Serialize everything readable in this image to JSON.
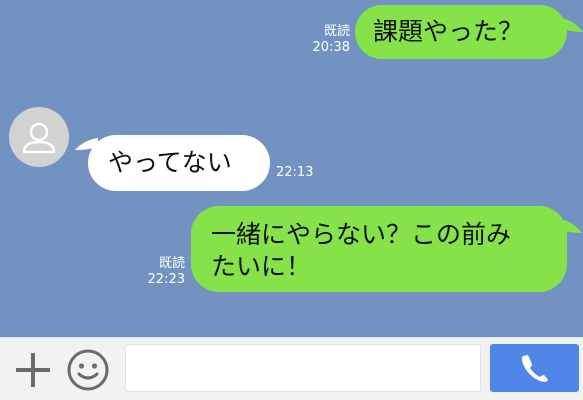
{
  "chat": {
    "messages": [
      {
        "sender": "me",
        "lines": [
          "課題やった？"
        ],
        "read": "既読",
        "time": "20:38"
      },
      {
        "sender": "friend",
        "lines": [
          "やってない"
        ],
        "time": "22:13"
      },
      {
        "sender": "me",
        "lines": [
          "一緒にやらない？この前み",
          "たいに！"
        ],
        "read": "既読",
        "time": "22:23"
      }
    ]
  },
  "input": {
    "placeholder": ""
  },
  "icons": {
    "add": "plus-icon",
    "emoji": "smiley-icon",
    "send": "phone-icon",
    "avatar": "user-icon"
  },
  "colors": {
    "background": "#7293c2",
    "sent_bubble": "#85e249",
    "received_bubble": "#ffffff",
    "send_button": "#4f86e8",
    "input_bar": "#f2f2f2"
  }
}
